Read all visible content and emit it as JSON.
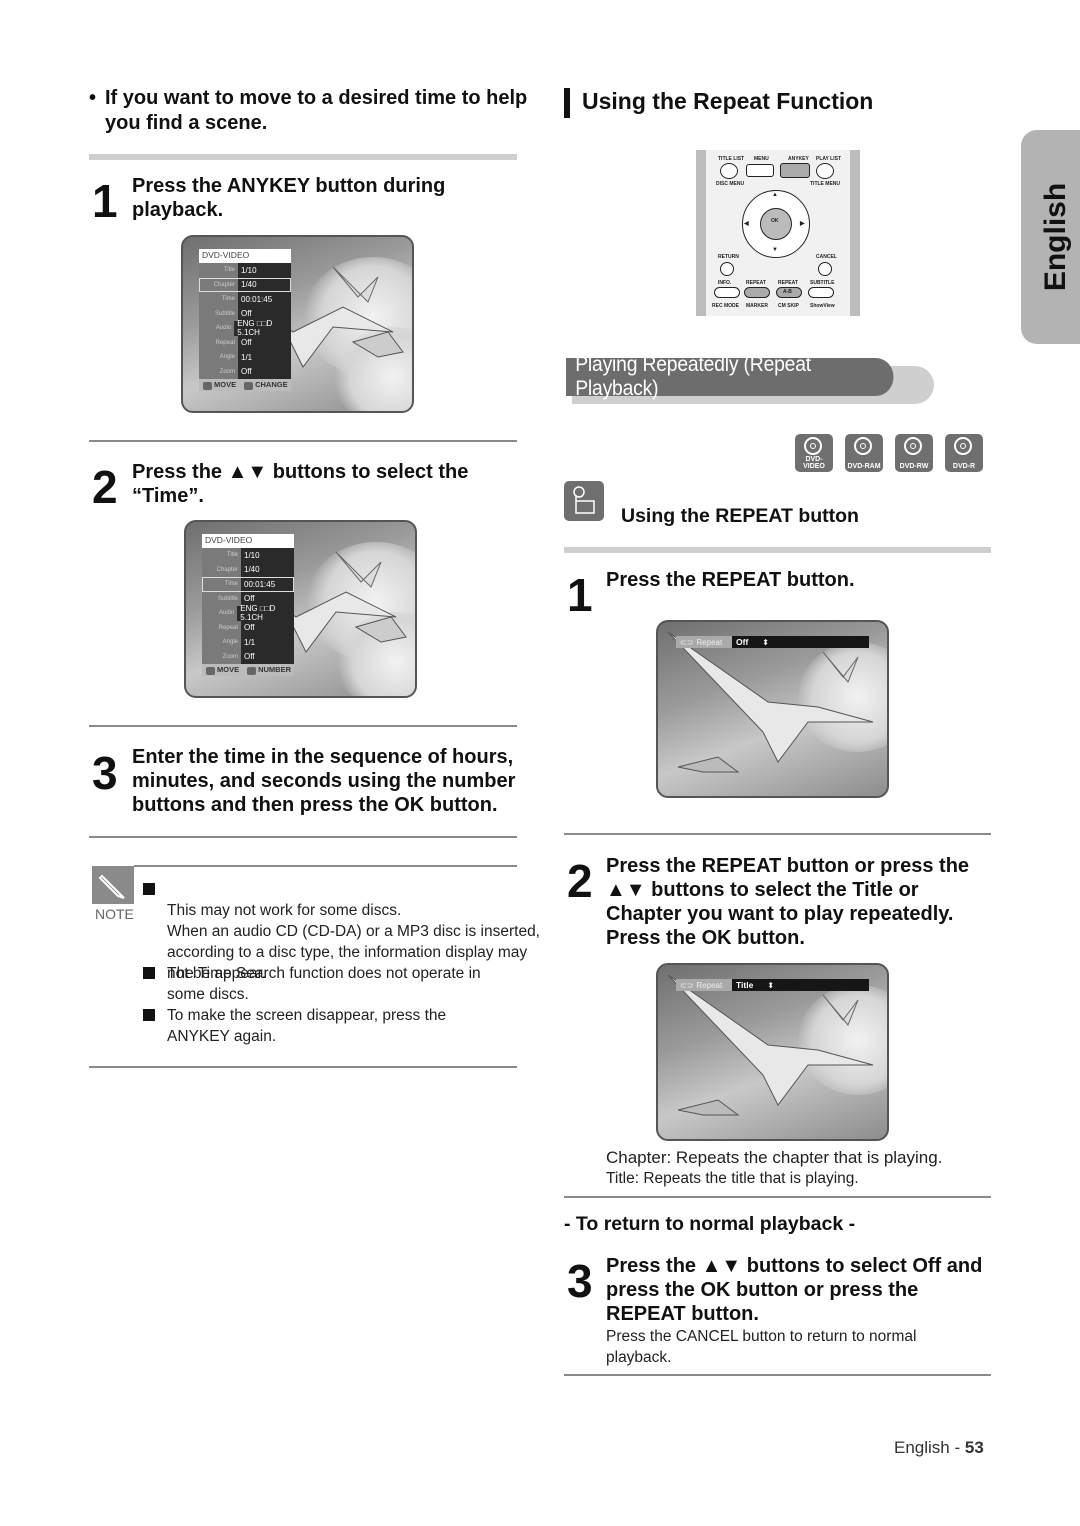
{
  "left": {
    "intro": "If you want to move to a desired time to help you find a scene.",
    "steps": [
      {
        "num": "1",
        "text": "Press the ANYKEY button during playback."
      },
      {
        "num": "2",
        "text": "Press the ▲▼ buttons to select the “Time”."
      },
      {
        "num": "3",
        "text": "Enter the time in the sequence of hours, minutes, and seconds using the number buttons and then press the OK button."
      }
    ],
    "osd1": {
      "header": "DVD-VIDEO",
      "rows": [
        {
          "label": "Title",
          "value": "1/10"
        },
        {
          "label": "Chapter",
          "value": "1/40"
        },
        {
          "label": "Time",
          "value": "00:01:45"
        },
        {
          "label": "Subtitle",
          "value": "Off"
        },
        {
          "label": "Audio",
          "value": "ENG □□D 5.1CH"
        },
        {
          "label": "Repeat",
          "value": "Off"
        },
        {
          "label": "Angle",
          "value": "1/1"
        },
        {
          "label": "Zoom",
          "value": "Off"
        }
      ],
      "footer_move": "MOVE",
      "footer_action": "CHANGE"
    },
    "osd2": {
      "header": "DVD-VIDEO",
      "rows": [
        {
          "label": "Title",
          "value": "1/10"
        },
        {
          "label": "Chapter",
          "value": "1/40"
        },
        {
          "label": "Time",
          "value": "00:01:45"
        },
        {
          "label": "Subtitle",
          "value": "Off"
        },
        {
          "label": "Audio",
          "value": "ENG □□D 5.1CH"
        },
        {
          "label": "Repeat",
          "value": "Off"
        },
        {
          "label": "Angle",
          "value": "1/1"
        },
        {
          "label": "Zoom",
          "value": "Off"
        }
      ],
      "footer_move": "MOVE",
      "footer_action": "NUMBER"
    },
    "note": {
      "label": "NOTE",
      "items": [
        "This may not work for some discs.\nWhen an audio CD (CD-DA) or a MP3 disc is inserted, according to a disc type, the information display may not be appear.",
        "The Time Search function does not operate in some discs.",
        "To make the screen disappear, press the ANYKEY again."
      ]
    }
  },
  "right": {
    "section_title": "Using the Repeat Function",
    "remote": {
      "labels": [
        "TITLE LIST",
        "MENU",
        "ANYKEY",
        "PLAY LIST",
        "DISC MENU",
        "TITLE MENU",
        "OK",
        "RETURN",
        "CANCEL",
        "INFO.",
        "REPEAT",
        "REPEAT",
        "SUBTITLE",
        "A-B",
        "REC MODE",
        "MARKER",
        "CM SKIP",
        "ShowView"
      ]
    },
    "banner": "Playing Repeatedly (Repeat Playback)",
    "discs": [
      "DVD-VIDEO",
      "DVD-RAM",
      "DVD-RW",
      "DVD-R"
    ],
    "sub_title": "Using the REPEAT button",
    "steps": [
      {
        "num": "1",
        "text": "Press the REPEAT button."
      },
      {
        "num": "2",
        "text": "Press the REPEAT button or press the ▲▼ buttons to select the Title or Chapter you want to play repeatedly. Press the OK button."
      },
      {
        "num": "3",
        "text": "Press the ▲▼ buttons to select Off and press the OK button or press the REPEAT button."
      }
    ],
    "repeat_osd1": {
      "label": "Repeat",
      "value": "Off"
    },
    "repeat_osd2": {
      "label": "Repeat",
      "value": "Title"
    },
    "chapter_desc": "Chapter: Repeats the chapter that is playing.",
    "title_desc": "Title: Repeats the title that is playing.",
    "return_heading": "- To return to normal playback -",
    "cancel_note": "Press the CANCEL button to return to normal playback."
  },
  "side_tab": "English",
  "footer": {
    "lang": "English - ",
    "page": "53"
  }
}
